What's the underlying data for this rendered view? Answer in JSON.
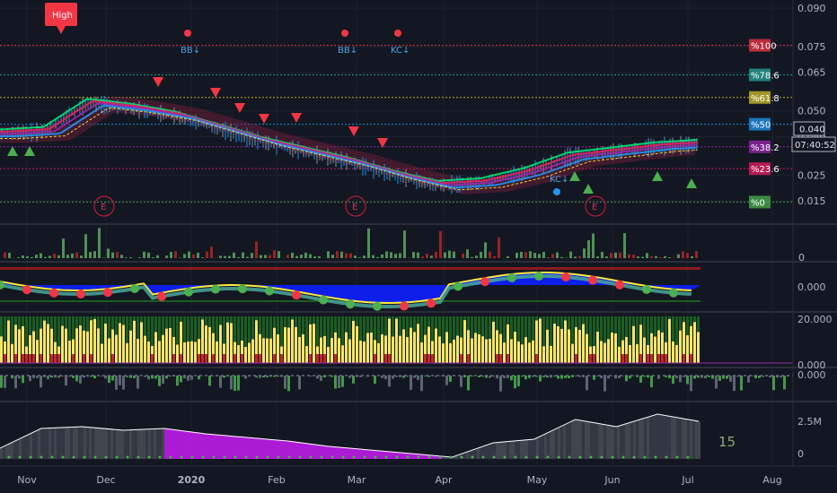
{
  "chart_data": {
    "type": "line",
    "title": "",
    "xlabel": "",
    "ylabel": "",
    "ylim": [
      0.01,
      0.092
    ],
    "y_ticks": [
      "0.090",
      "0.075",
      "0.065",
      "0.050",
      "0.040",
      "0.025",
      "0.015"
    ],
    "x_ticks": [
      "Nov",
      "Dec",
      "2020",
      "Feb",
      "Mar",
      "Apr",
      "May",
      "Jun",
      "Jul",
      "Aug"
    ],
    "current_price_label": "0.040",
    "countdown_label": "07:40:52",
    "high_label": "High",
    "event_labels": [
      "BB↓",
      "BB↓",
      "KC↓",
      "KC↓"
    ],
    "earnings_label": "E",
    "fib_levels": [
      {
        "label": "%100",
        "price": 0.0755,
        "color": "#f23645"
      },
      {
        "label": "%78.6",
        "price": 0.064,
        "color": "#26a69a"
      },
      {
        "label": "%61.8",
        "price": 0.0552,
        "color": "#d1c22a"
      },
      {
        "label": "%50",
        "price": 0.0448,
        "color": "#2196f3"
      },
      {
        "label": "%38.2",
        "price": 0.036,
        "color": "#9c27b0"
      },
      {
        "label": "%23.6",
        "price": 0.0275,
        "color": "#e91e63"
      },
      {
        "label": "%0",
        "price": 0.0145,
        "color": "#4caf50"
      }
    ],
    "price_x": [
      "Nov",
      "Nov",
      "Dec",
      "Dec",
      "2020",
      "2020",
      "Feb",
      "Feb",
      "Mar",
      "Mar",
      "Apr",
      "Apr",
      "May",
      "May",
      "Jun",
      "Jun",
      "Jul"
    ],
    "series": [
      {
        "values": [
          0.041,
          0.042,
          0.053,
          0.051,
          0.048,
          0.043,
          0.038,
          0.034,
          0.03,
          0.025,
          0.021,
          0.022,
          0.026,
          0.032,
          0.034,
          0.036,
          0.037
        ]
      }
    ],
    "panes": {
      "oscillator_tick": "0.000",
      "volume_tick": "20.000",
      "volume_tick_low": "0.000",
      "histogram_tick": "0.000",
      "obv_tick_high": "2.5M",
      "obv_tick_low": "0",
      "obv_badge": "15"
    }
  },
  "colors": {
    "background": "#131722",
    "grid": "#1e222d",
    "axis_text": "#b2b5be",
    "bear_marker": "#f23645",
    "bull_marker": "#4caf50",
    "ma_yellow": "#ffeb3b",
    "ma_pink": "#e91e63",
    "ma_green": "#00e676",
    "ma_blue": "#2196f3",
    "ma_purple": "#9c27b0",
    "volume_yellow": "#f5e663",
    "volume_dark_green": "#1b5e20",
    "osc_blue": "#0d1fff",
    "obv_purple": "#c71cf5"
  }
}
